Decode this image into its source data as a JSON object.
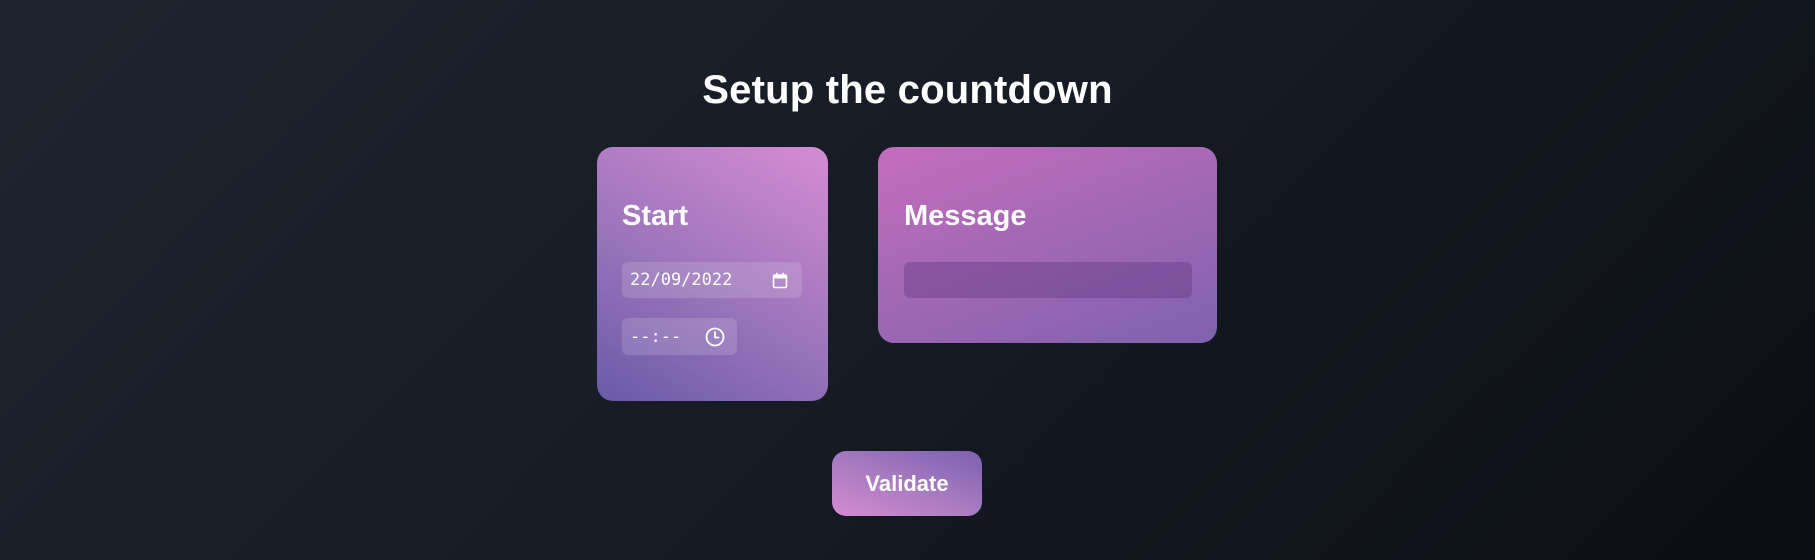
{
  "page": {
    "title": "Setup the countdown"
  },
  "start_card": {
    "title": "Start",
    "date_value": "22/09/2022",
    "date_icon": "calendar-icon",
    "time_value": "--:--",
    "time_icon": "clock-icon"
  },
  "message_card": {
    "title": "Message",
    "input_value": ""
  },
  "actions": {
    "validate_label": "Validate"
  },
  "colors": {
    "background_dark": "#0b0e14",
    "background_light": "#1e2530",
    "accent_purple": "#6a5aa8",
    "accent_pink": "#d68bd4",
    "text": "#ffffff"
  }
}
